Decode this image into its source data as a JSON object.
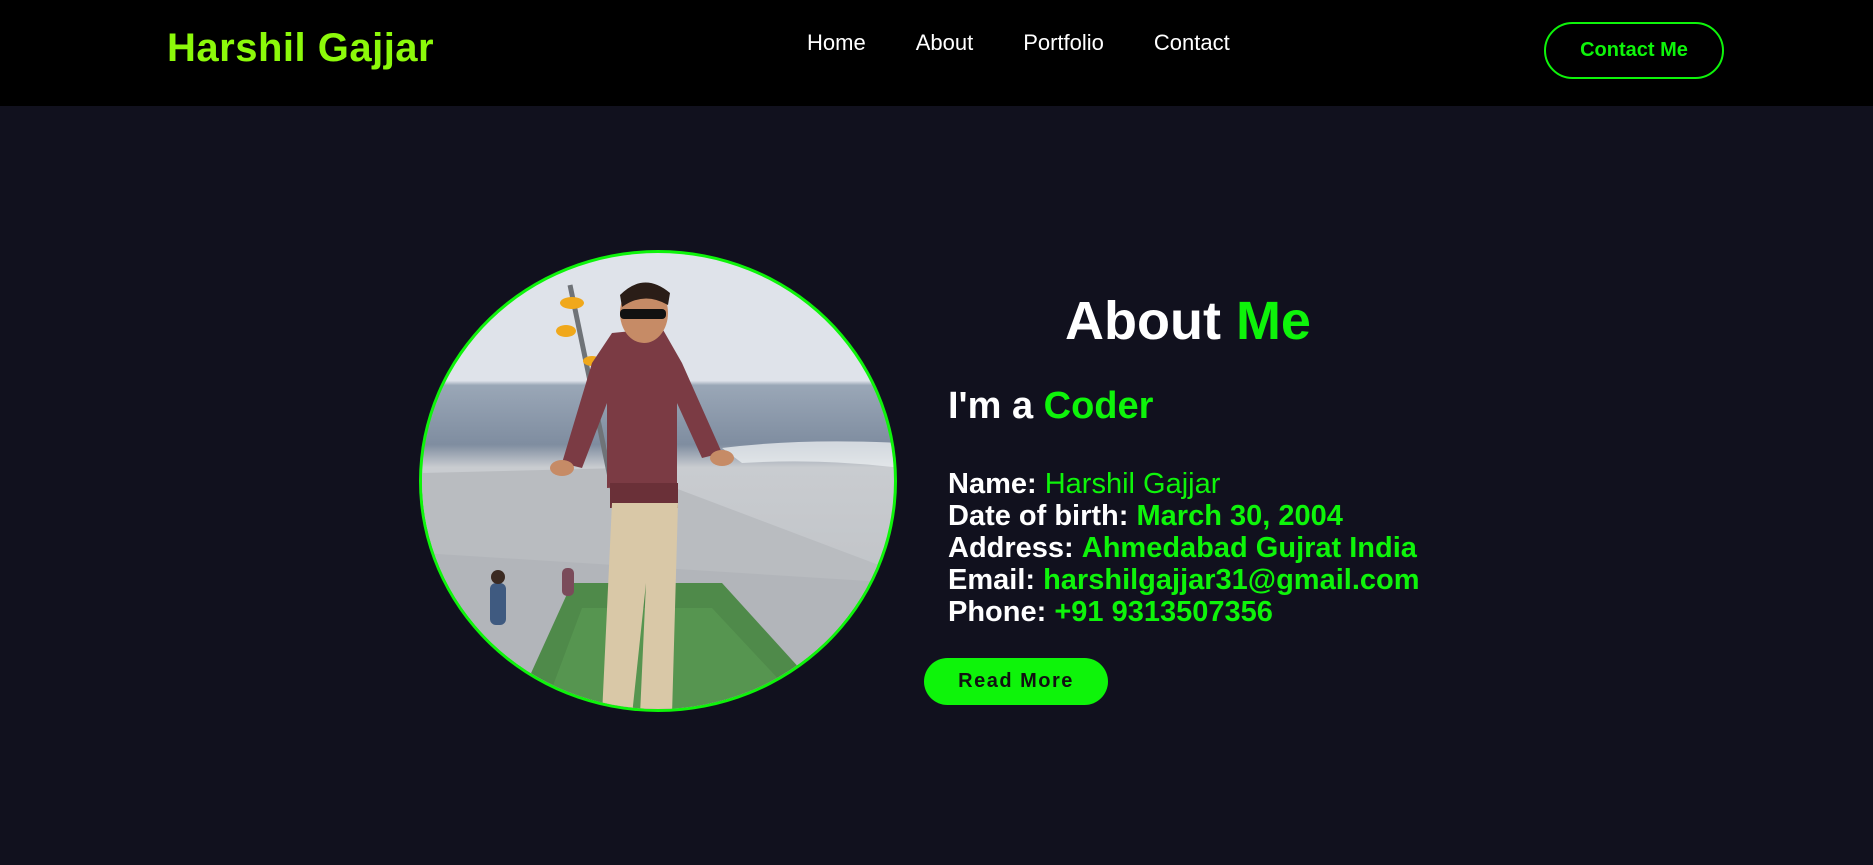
{
  "brand": {
    "logo_text": "Harshil Gajjar",
    "logo_color": "#8cf90a",
    "accent_color": "#0ef40a",
    "background": "#11111e",
    "nav_background": "#000000"
  },
  "nav": {
    "links": [
      "Home",
      "About",
      "Portfolio",
      "Contact"
    ],
    "contact_button": "Contact Me"
  },
  "about": {
    "title_prefix": "About",
    "title_accent": "Me",
    "subtitle_prefix": "I'm a",
    "subtitle_accent": "Coder",
    "photo_alt": "profile-photo",
    "details": [
      {
        "label": "Name:",
        "value": "Harshil Gajjar"
      },
      {
        "label": "Date of birth:",
        "value": "March 30, 2004"
      },
      {
        "label": "Address:",
        "value": "Ahmedabad Gujrat India"
      },
      {
        "label": "Email:",
        "value": "harshilgajjar31@gmail.com"
      },
      {
        "label": "Phone:",
        "value": "+91 9313507356"
      }
    ],
    "read_more_label": "Read More"
  }
}
